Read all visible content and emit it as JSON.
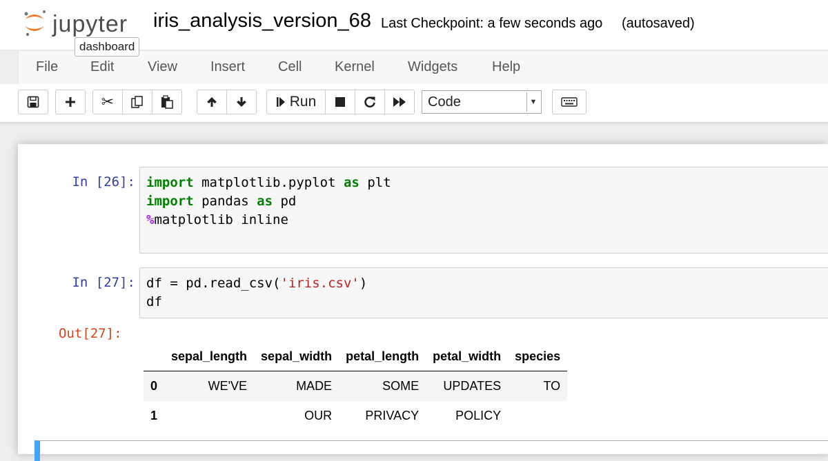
{
  "header": {
    "logo_text": "jupyter",
    "tooltip": "dashboard",
    "notebook_name": "iris_analysis_version_68",
    "checkpoint": "Last Checkpoint: a few seconds ago",
    "autosave": "(autosaved)"
  },
  "menu": [
    "File",
    "Edit",
    "View",
    "Insert",
    "Cell",
    "Kernel",
    "Widgets",
    "Help"
  ],
  "toolbar": {
    "icons": {
      "save": "save-icon",
      "insert": "plus-icon",
      "cut": "scissors-icon",
      "copy": "copy-icon",
      "paste": "paste-icon",
      "move_up": "arrow-up-icon",
      "move_down": "arrow-down-icon",
      "interrupt": "stop-icon",
      "restart": "restart-icon",
      "run_all": "fast-forward-icon",
      "keyboard": "keyboard-icon"
    },
    "run_label": "Run",
    "cell_type": "Code"
  },
  "cells": [
    {
      "prompt": "In [26]:",
      "lines": [
        [
          {
            "t": "import",
            "c": "kw"
          },
          {
            "t": " matplotlib.pyplot ",
            "c": ""
          },
          {
            "t": "as",
            "c": "kw"
          },
          {
            "t": " plt",
            "c": ""
          }
        ],
        [
          {
            "t": "import",
            "c": "kw"
          },
          {
            "t": " pandas ",
            "c": ""
          },
          {
            "t": "as",
            "c": "kw"
          },
          {
            "t": " pd",
            "c": ""
          }
        ],
        [
          {
            "t": "%",
            "c": "magic"
          },
          {
            "t": "matplotlib inline",
            "c": ""
          }
        ]
      ]
    },
    {
      "prompt": "In [27]:",
      "lines": [
        [
          {
            "t": "df = pd.read_csv(",
            "c": ""
          },
          {
            "t": "'iris.csv'",
            "c": "str"
          },
          {
            "t": ")",
            "c": ""
          }
        ],
        [
          {
            "t": "df",
            "c": ""
          }
        ]
      ],
      "out_prompt": "Out[27]:"
    }
  ],
  "dataframe": {
    "columns": [
      "",
      "sepal_length",
      "sepal_width",
      "petal_length",
      "petal_width",
      "species"
    ],
    "rows": [
      [
        "0",
        "WE'VE",
        "MADE",
        "SOME",
        "UPDATES",
        "TO"
      ],
      [
        "1",
        "",
        "OUR",
        "PRIVACY",
        "POLICY",
        ""
      ]
    ]
  },
  "colors": {
    "in_prompt": "#303f9f",
    "out_prompt": "#d84315",
    "keyword": "#008000",
    "magic": "#aa22ff",
    "string": "#ba2121",
    "selected_cell": "#42a5f5",
    "logo_orange": "#f37726"
  }
}
